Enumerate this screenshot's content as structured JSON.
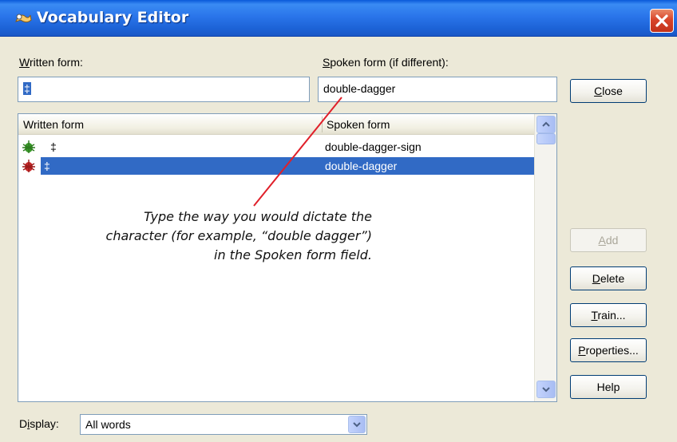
{
  "window": {
    "title": "Vocabulary Editor"
  },
  "written_form": {
    "label_underlined": "W",
    "label_rest": "ritten form:",
    "value": "‡"
  },
  "spoken_form": {
    "label_underlined": "S",
    "label_rest": "poken form (if different):",
    "value": "double-dagger"
  },
  "list": {
    "columns": [
      "Written form",
      "Spoken form"
    ],
    "rows": [
      {
        "written": "‡",
        "spoken": "double-dagger-sign",
        "selected": false,
        "icon": "green-bug-icon"
      },
      {
        "written": "‡",
        "spoken": "double-dagger",
        "selected": true,
        "icon": "red-bug-icon"
      }
    ]
  },
  "buttons": {
    "close": {
      "ul": "C",
      "rest": "lose"
    },
    "add": {
      "ul": "A",
      "rest": "dd",
      "disabled": true
    },
    "delete": {
      "ul": "D",
      "rest": "elete"
    },
    "train": {
      "ul": "T",
      "rest": "rain..."
    },
    "properties": {
      "ul": "P",
      "rest": "roperties..."
    },
    "help": {
      "label": "Help"
    }
  },
  "display": {
    "label_pre": "D",
    "label_ul": "i",
    "label_rest": "splay:",
    "value": "All words"
  },
  "callout": {
    "text": "Type the way you would dictate the character (for example, “double dagger”) in the Spoken form field."
  },
  "colors": {
    "selection": "#316ac5",
    "title_bar": "#2a75ea",
    "callout_line": "#e0202a"
  }
}
